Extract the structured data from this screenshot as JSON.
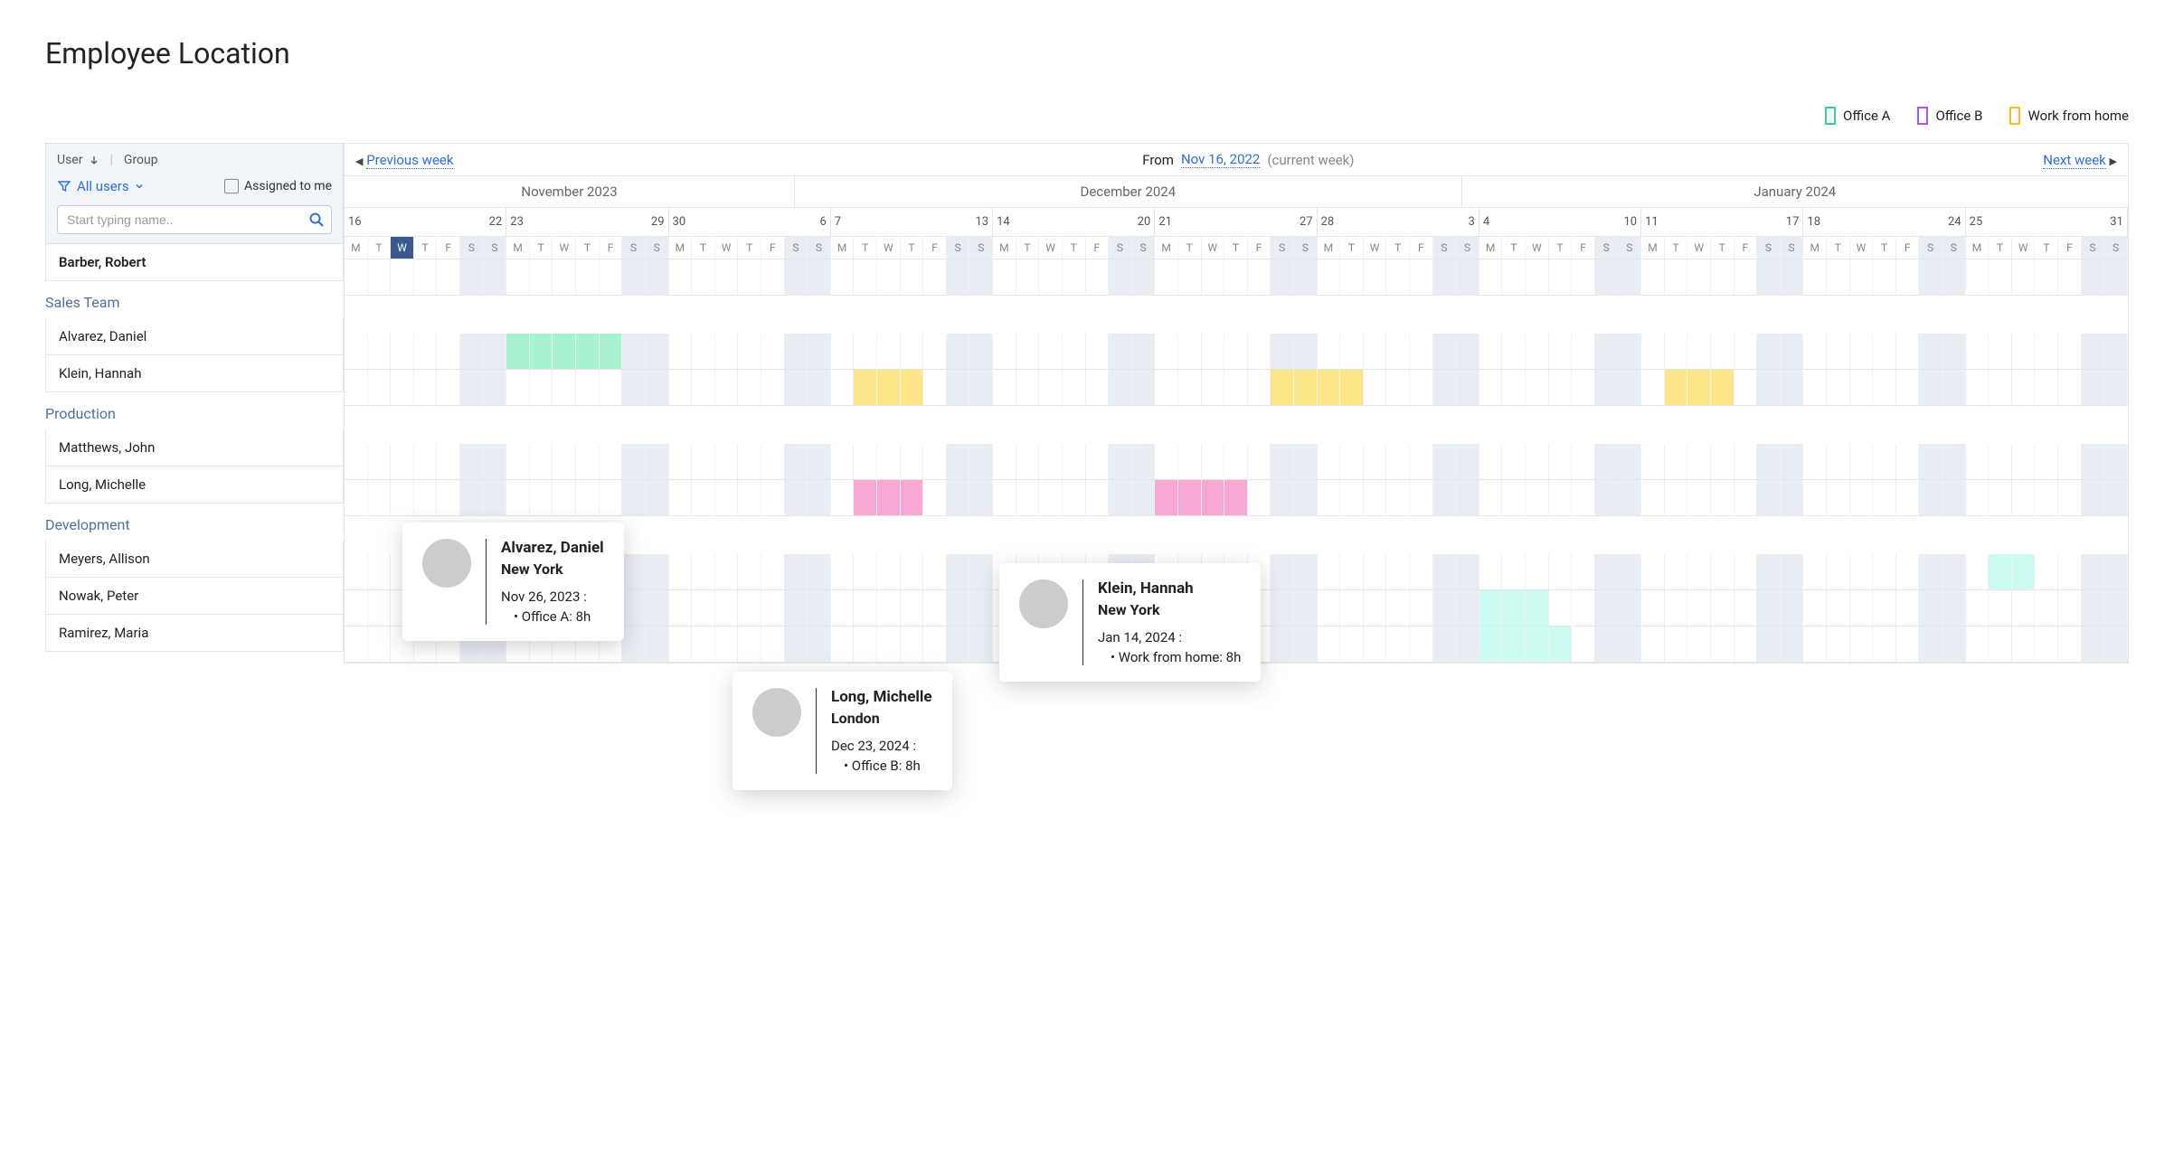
{
  "title": "Employee Location",
  "legend": [
    {
      "label": "Office A",
      "color": "#34d399"
    },
    {
      "label": "Office B",
      "color": "#a855f7"
    },
    {
      "label": "Work from home",
      "color": "#fbbf24"
    }
  ],
  "sidebar": {
    "sort_user": "User",
    "sort_group": "Group",
    "filter_label": "All users",
    "assigned_label": "Assigned to me",
    "search_placeholder": "Start typing name.."
  },
  "current_user": "Barber, Robert",
  "groups": [
    {
      "name": "Sales Team",
      "users": [
        "Alvarez, Daniel",
        "Klein, Hannah"
      ]
    },
    {
      "name": "Production",
      "users": [
        "Matthews, John",
        "Long, Michelle"
      ]
    },
    {
      "name": "Development",
      "users": [
        "Meyers, Allison",
        "Nowak, Peter",
        "Ramirez, Maria"
      ]
    }
  ],
  "nav": {
    "prev": "Previous week",
    "next": "Next week",
    "from_label": "From",
    "from_date": "Nov 16, 2022",
    "current": "(current week)"
  },
  "months": [
    "November 2023",
    "December 2024",
    "January 2024"
  ],
  "week_starts": [
    "16",
    "22",
    "23",
    "29",
    "30",
    "6",
    "7",
    "13",
    "14",
    "20",
    "21",
    "27",
    "28",
    "3",
    "4",
    "10",
    "11",
    "17",
    "18",
    "24",
    "25",
    "31"
  ],
  "dow": [
    "M",
    "T",
    "W",
    "T",
    "F",
    "S",
    "S"
  ],
  "tooltips": {
    "t1": {
      "name": "Alvarez, Daniel",
      "city": "New York",
      "date": "Nov 26, 2023 :",
      "detail": "•  Office A: 8h"
    },
    "t2": {
      "name": "Long, Michelle",
      "city": "London",
      "date": "Dec 23, 2024 :",
      "detail": "•  Office B: 8h"
    },
    "t3": {
      "name": "Klein, Hannah",
      "city": "New York",
      "date": "Jan 14, 2024 :",
      "detail": "•  Work from home: 8h"
    }
  }
}
